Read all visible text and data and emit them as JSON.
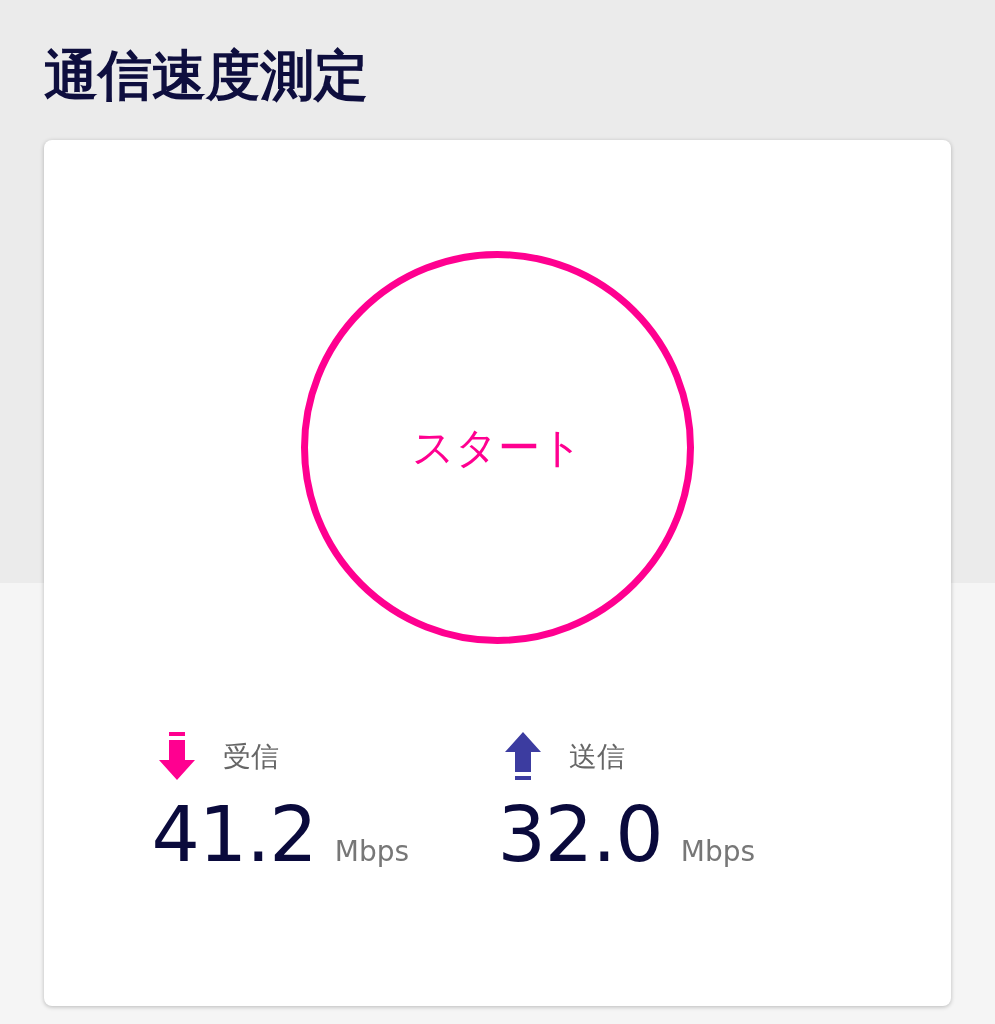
{
  "title": "通信速度測定",
  "start_button": {
    "label": "スタート"
  },
  "results": [
    {
      "kind": "download",
      "color": "#ff0090",
      "label": "受信",
      "value": "41.2",
      "unit": "Mbps"
    },
    {
      "kind": "upload",
      "color": "#3c3ca0",
      "label": "送信",
      "value": "32.0",
      "unit": "Mbps"
    }
  ]
}
